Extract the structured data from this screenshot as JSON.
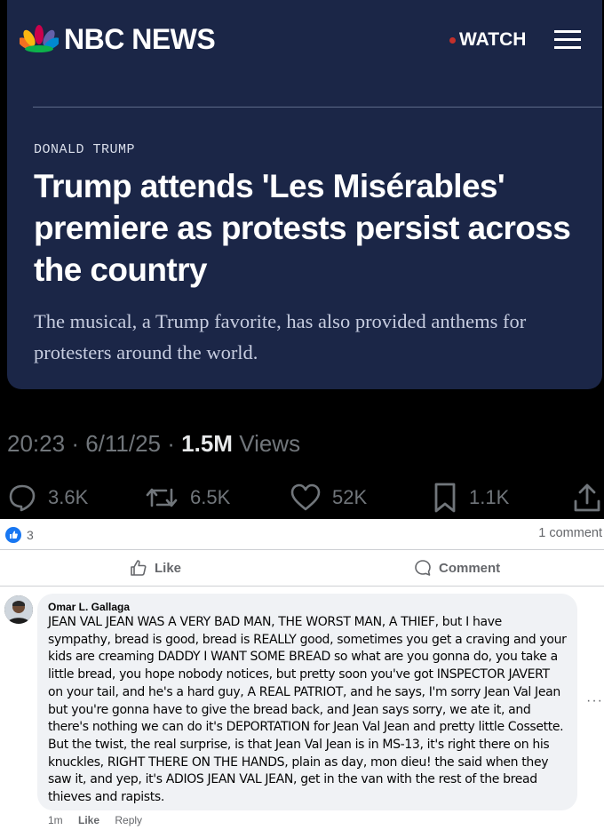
{
  "tweet": {
    "brand": "NBC NEWS",
    "watch_label": "WATCH",
    "section": "DONALD TRUMP",
    "headline": "Trump attends 'Les Misérables' premiere as protests persist across the country",
    "dek": "The musical, a Trump favorite, has also provided anthems for protesters around the world.",
    "time": "20:23",
    "date": "6/11/25",
    "views_count": "1.5M",
    "views_label": "Views",
    "replies": "3.6K",
    "reposts": "6.5K",
    "likes": "52K",
    "bookmarks": "1.1K"
  },
  "post": {
    "reaction_count": "3",
    "comment_count_label": "1 comment",
    "like_label": "Like",
    "comment_label": "Comment"
  },
  "comment": {
    "author": "Omar L. Gallaga",
    "text": "JEAN VAL JEAN WAS A VERY BAD MAN, THE WORST MAN, A THIEF, but I have sympathy, bread is good, bread is REALLY good, sometimes you get a craving and your kids are creaming DADDY I WANT SOME BREAD so what are you gonna do, you take a little bread, you hope nobody notices, but pretty soon you've got INSPECTOR JAVERT on your tail, and he's a hard guy, A REAL PATRIOT, and he says, I'm sorry Jean Val Jean but you're gonna have to give the bread back, and Jean says sorry, we ate it, and there's nothing we can do it's DEPORTATION for Jean Val Jean and pretty little Cossette. But the twist, the real surprise, is that Jean Val Jean is in MS-13, it's right there on his knuckles, RIGHT THERE ON THE HANDS, plain as day, mon dieu! the said when they saw it, and yep, it's ADIOS JEAN VAL JEAN, get in the van with the rest of the bread thieves and rapists.",
    "time": "1m",
    "like": "Like",
    "reply": "Reply"
  },
  "colors": {
    "card_bg": "#1b2647",
    "fb_blue": "#1877f2",
    "bubble_bg": "#f0f2f5"
  }
}
